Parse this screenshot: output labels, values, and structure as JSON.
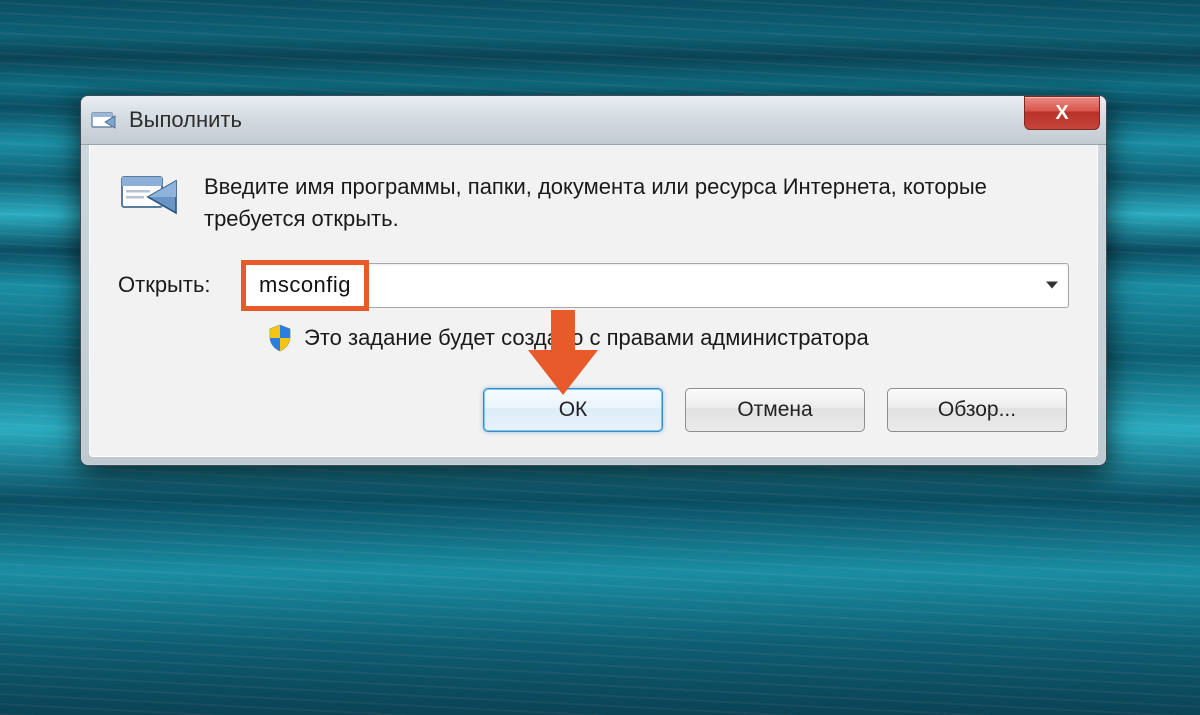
{
  "dialog": {
    "title": "Выполнить",
    "close_glyph": "X",
    "description": "Введите имя программы, папки, документа или ресурса Интернета, которые требуется открыть.",
    "open_label": "Открыть:",
    "input_value": "msconfig",
    "admin_note": "Это задание будет создано с правами администратора",
    "buttons": {
      "ok": "ОК",
      "cancel": "Отмена",
      "browse": "Обзор..."
    }
  },
  "annotation": {
    "highlight_color": "#e85a2a"
  }
}
